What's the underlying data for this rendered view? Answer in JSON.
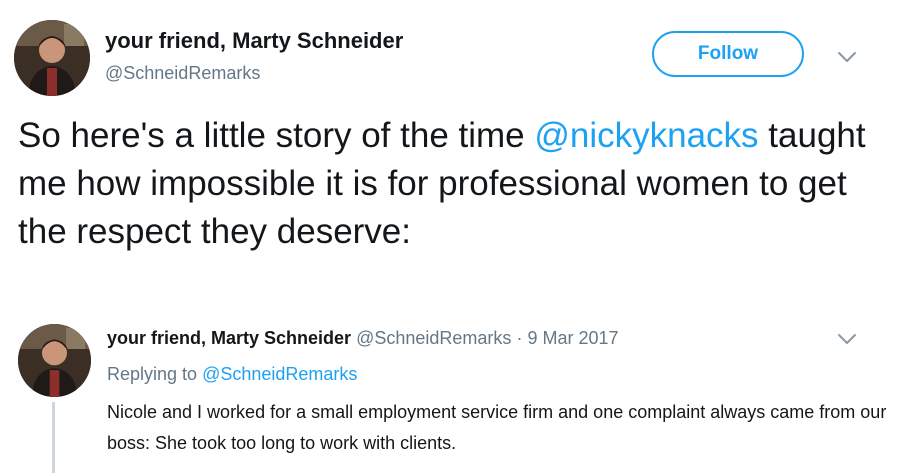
{
  "tweet": {
    "author_name": "your friend, Marty Schneider",
    "author_handle": "@SchneidRemarks",
    "follow_label": "Follow",
    "text_before": "So here's a little story of the time ",
    "mention": "@nickyknacks",
    "text_after": " taught me how impossible it is for professional women to get the respect they deserve:",
    "menu_icon": "chevron-down-icon"
  },
  "reply": {
    "author_name": "your friend, Marty Schneider",
    "author_handle": "@SchneidRemarks",
    "separator": "·",
    "date": "9 Mar 2017",
    "replying_label": "Replying to",
    "replying_handle": "@SchneidRemarks",
    "text": "Nicole and I worked for a small employment service firm and one complaint always came from our boss: She took too long to work with clients.",
    "menu_icon": "chevron-down-icon"
  },
  "colors": {
    "accent": "#1da1f2",
    "text_primary": "#14171a",
    "text_secondary": "#657786",
    "thread_line": "#ccd6dd"
  }
}
